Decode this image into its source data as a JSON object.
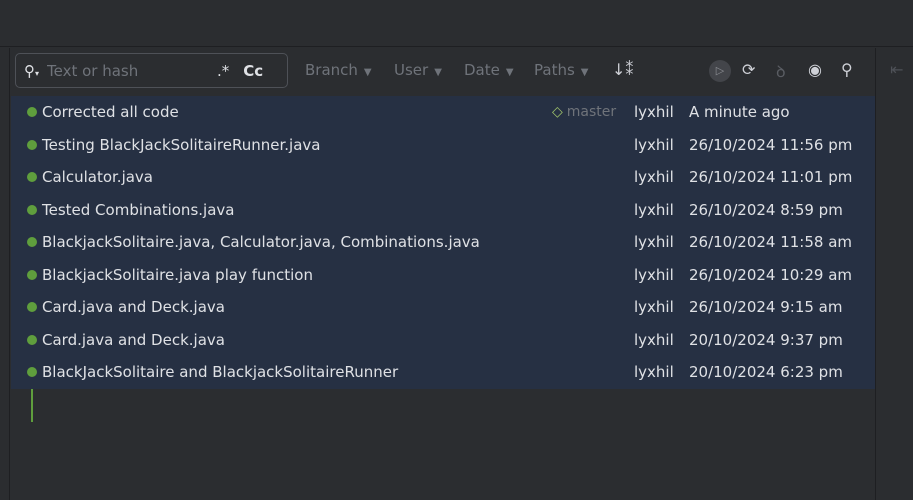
{
  "search": {
    "placeholder": "Text or hash",
    "regex_label": ".*",
    "case_label": "Cc"
  },
  "filters": [
    {
      "label": "Branch"
    },
    {
      "label": "User"
    },
    {
      "label": "Date"
    },
    {
      "label": "Paths"
    }
  ],
  "commits": [
    {
      "message": "Corrected all code",
      "tag": "master",
      "author": "lyxhil",
      "date": "A minute ago"
    },
    {
      "message": "Testing BlackJackSolitaireRunner.java",
      "author": "lyxhil",
      "date": "26/10/2024 11:56 pm"
    },
    {
      "message": "Calculator.java",
      "author": "lyxhil",
      "date": "26/10/2024 11:01 pm"
    },
    {
      "message": "Tested Combinations.java",
      "author": "lyxhil",
      "date": "26/10/2024 8:59 pm"
    },
    {
      "message": "BlackjackSolitaire.java, Calculator.java, Combinations.java",
      "author": "lyxhil",
      "date": "26/10/2024 11:58 am"
    },
    {
      "message": "BlackjackSolitaire.java play function",
      "author": "lyxhil",
      "date": "26/10/2024 10:29 am"
    },
    {
      "message": "Card.java and Deck.java",
      "author": "lyxhil",
      "date": "26/10/2024 9:15 am"
    },
    {
      "message": "Card.java and Deck.java",
      "author": "lyxhil",
      "date": "20/10/2024 9:37 pm"
    },
    {
      "message": "BlackJackSolitaire and BlackjackSolitaireRunner",
      "author": "lyxhil",
      "date": "20/10/2024 6:23 pm"
    }
  ]
}
